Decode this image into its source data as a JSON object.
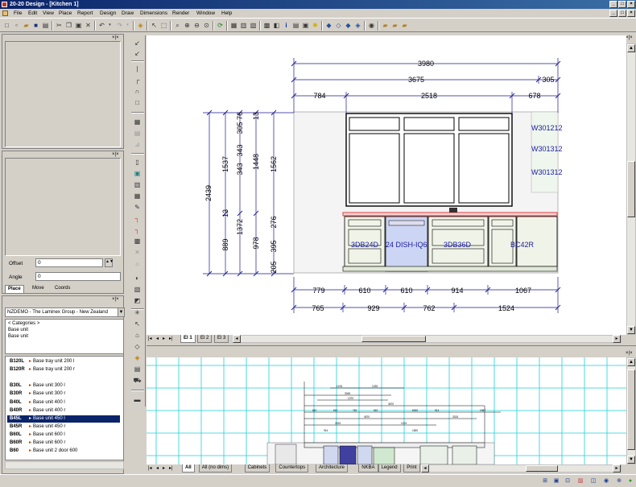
{
  "window": {
    "title": "20-20 Design - [Kitchen 1]",
    "controls": [
      "_",
      "□",
      "×"
    ],
    "child_controls": [
      "_",
      "□",
      "×"
    ]
  },
  "menu": [
    "File",
    "Edit",
    "View",
    "Place",
    "Report",
    "Design",
    "Draw",
    "Dimensions",
    "Render",
    "Window",
    "Help"
  ],
  "panels": {
    "top_close": "×|×",
    "offset_label": "Offset",
    "offset_value": "0",
    "angle_label": "Angle",
    "angle_value": "0",
    "tabs": [
      "Place",
      "Move",
      "Coords"
    ]
  },
  "catalog": {
    "selected": "NZDEMO - The Laminex Group - New Zealand",
    "breadcrumb": [
      "< Categories >",
      "Base unit",
      "Base unit"
    ],
    "items": [
      {
        "code": "B120L",
        "desc": "Base tray unit 200 l"
      },
      {
        "code": "B120R",
        "desc": "Base tray unit 200 r"
      },
      {
        "code": "",
        "desc": ""
      },
      {
        "code": "B30L",
        "desc": "Base unit 300 l"
      },
      {
        "code": "B30R",
        "desc": "Base unit 300 r"
      },
      {
        "code": "B40L",
        "desc": "Base unit 400 l"
      },
      {
        "code": "B40R",
        "desc": "Base unit 400 r"
      },
      {
        "code": "B45L",
        "desc": "Base unit 450 l"
      },
      {
        "code": "B45R",
        "desc": "Base unit 450 r"
      },
      {
        "code": "B60L",
        "desc": "Base unit 600 l"
      },
      {
        "code": "B60R",
        "desc": "Base unit 600 r"
      },
      {
        "code": "B60",
        "desc": "Base unit 2 door 600"
      }
    ],
    "selected_index": 7
  },
  "elevation": {
    "top_dims": [
      "3980",
      "3675",
      "305",
      "784",
      "2518",
      "678"
    ],
    "left_dims": [
      "2439",
      "1537",
      "343",
      "343",
      "305",
      "76",
      "13",
      "1448",
      "1562",
      "13",
      "889",
      "1372",
      "978",
      "276",
      "395",
      "205"
    ],
    "bottom_dims_row1": [
      "779",
      "610",
      "610",
      "914",
      "1067"
    ],
    "bottom_dims_row2": [
      "765",
      "929",
      "762",
      "1524"
    ],
    "labels": [
      "W301212",
      "W301312",
      "W301312",
      "3DB24D",
      "24 DISH-IQ6",
      "3DB36D",
      "BC42R"
    ],
    "tabs": [
      "El 1",
      "El 2",
      "El 3"
    ],
    "active_tab": "El 1"
  },
  "plan": {
    "tabs": [
      "All",
      "All (no dims)",
      "Cabinets",
      "Countertops",
      "Architecture",
      "NKBA",
      "Legend",
      "Print"
    ],
    "active_tab": "All",
    "dims": [
      "1215",
      "1235",
      "3045",
      "1370",
      "3670",
      "610",
      "610",
      "762",
      "610",
      "6000",
      "914",
      "1067",
      "4570",
      "3315",
      "2515",
      "1219",
      "914",
      "1830"
    ]
  },
  "colors": {
    "dim_line": "#1a1a8c",
    "grid": "#1ecfd8",
    "selection": "#0a246a",
    "countertop": "#e04040"
  }
}
